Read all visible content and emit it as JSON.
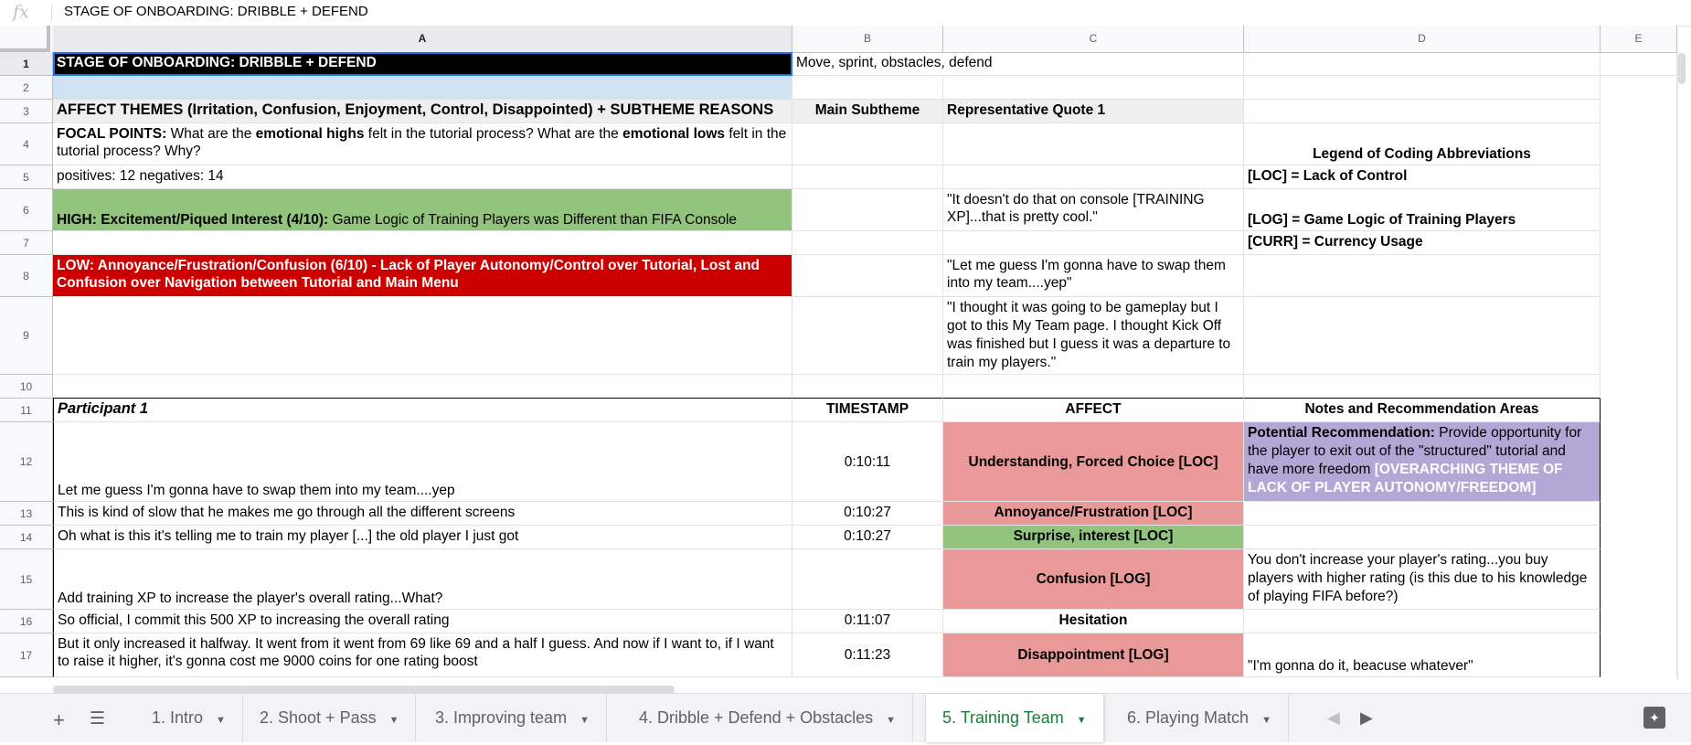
{
  "formula_bar": {
    "fx": "fx",
    "content": "STAGE OF ONBOARDING: DRIBBLE + DEFEND"
  },
  "columns": [
    "A",
    "B",
    "C",
    "D",
    "E"
  ],
  "rows": [
    "1",
    "2",
    "3",
    "4",
    "5",
    "6",
    "7",
    "8",
    "9",
    "10",
    "11",
    "12",
    "13",
    "14",
    "15",
    "16",
    "17"
  ],
  "cells": {
    "a1": "STAGE OF ONBOARDING: DRIBBLE + DEFEND",
    "b1": "Move, sprint, obstacles, defend",
    "a3": "AFFECT THEMES (Irritation, Confusion, Enjoyment, Control, Disappointed) + SUBTHEME REASONS",
    "b3": "Main Subtheme",
    "c3": "Representative Quote 1",
    "a4_b1": "FOCAL POINTS:",
    "a4_t1": " What are the ",
    "a4_b2": "emotional highs",
    "a4_t2": " felt in the tutorial process? What are the ",
    "a4_b3": "emotional lows",
    "a4_t3": " felt in the tutorial process? Why?",
    "d4": "Legend of Coding Abbreviations",
    "a5": "positives: 12 negatives: 14",
    "d5": "[LOC] = Lack of Control",
    "a6_b": "HIGH: Excitement/Piqued Interest (4/10):",
    "a6_t": " Game Logic of Training Players was Different than FIFA Console",
    "c6": "\"It doesn't do that on console [TRAINING XP]...that is pretty cool.\"",
    "d6": "[LOG] = Game Logic of Training Players",
    "d7": "[CURR] = Currency Usage",
    "a8": "LOW: Annoyance/Frustration/Confusion (6/10) - Lack of Player Autonomy/Control over Tutorial, Lost and Confusion over Navigation between Tutorial and Main Menu",
    "c8": "\"Let me guess I'm gonna have to swap them into my team....yep\"",
    "c9": "\"I thought it was going to be gameplay but I got to this My Team page. I thought Kick Off was finished but I guess it was a departure to train my players.\"",
    "a11": "Participant 1",
    "b11": "TIMESTAMP",
    "c11": "AFFECT",
    "d11": "Notes and Recommendation Areas",
    "a12": "Let me guess I'm gonna have to swap them into my team....yep",
    "b12": "0:10:11",
    "c12": "Understanding, Forced Choice [LOC]",
    "d12_b": "Potential Recommendation:",
    "d12_t": " Provide opportunity for the player to exit out of the \"structured\" tutorial and have more freedom ",
    "d12_w": "[OVERARCHING THEME OF LACK OF PLAYER AUTONOMY/FREEDOM]",
    "a13": "This is kind of slow that he makes me go through all the different screens",
    "b13": "0:10:27",
    "c13": "Annoyance/Frustration [LOC]",
    "a14": "Oh what is this it's telling me to train my player [...] the old player I just got",
    "b14": "0:10:27",
    "c14": "Surprise, interest [LOC]",
    "a15": "Add training XP to increase the player's overall rating...What?",
    "c15": "Confusion [LOG]",
    "d15": "You don't increase your player's rating...you buy players with higher rating (is this due to his knowledge of playing FIFA before?)",
    "a16": "So official, I commit this 500 XP to increasing the overall rating",
    "b16": "0:11:07",
    "c16": "Hesitation",
    "a17": "But it only increased it halfway. It went from it went from 69 like 69 and a half I guess. And now if I want to, if I want to raise it higher, it's gonna cost me 9000 coins for one rating boost",
    "b17": "0:11:23",
    "c17": "Disappointment [LOG]",
    "d17": "\"I'm gonna do it, beacuse whatever\""
  },
  "tabs": [
    {
      "label": "1. Intro"
    },
    {
      "label": "2. Shoot + Pass"
    },
    {
      "label": "3. Improving team"
    },
    {
      "label": "4. Dribble + Defend + Obstacles"
    },
    {
      "label": "5. Training Team"
    },
    {
      "label": "6. Playing Match"
    }
  ],
  "active_tab": "5. Training Team",
  "colors": {
    "selection": "#1a73e8",
    "active_tab": "#188038",
    "high": "#93c47d",
    "low": "#cc0000",
    "negative": "#ea9999",
    "recommendation": "#b4a7d6"
  }
}
